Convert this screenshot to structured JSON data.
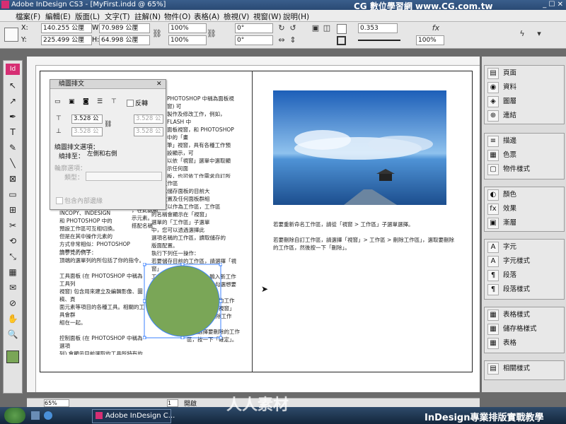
{
  "window": {
    "title": "Adobe InDesign CS3 - [MyFirst.indd @ 65%]",
    "brand": "CG 數位學習網 www.CG.com.tw",
    "controls": "_ ☐ ✕"
  },
  "menu": [
    "檔案(F)",
    "編輯(E)",
    "版面(L)",
    "文字(T)",
    "註解(N)",
    "物件(O)",
    "表格(A)",
    "檢視(V)",
    "視窗(W)",
    "說明(H)"
  ],
  "control": {
    "x_label": "X:",
    "x_value": "140.255 公厘",
    "y_label": "Y:",
    "y_value": "225.499 公厘",
    "w_label": "W:",
    "w_value": "70.989 公厘",
    "h_label": "H:",
    "h_value": "64.998 公厘",
    "scale_x": "100%",
    "scale_y": "100%",
    "rotate": "0°",
    "shear": "0°",
    "stroke": "0.353",
    "opacity": "100%"
  },
  "tools": [
    "selection-tool",
    "direct-selection-tool",
    "pen-tool",
    "type-tool",
    "pencil-tool",
    "line-tool",
    "rectangle-frame-tool",
    "rectangle-tool",
    "button-tool",
    "scissors-tool",
    "rotate-tool",
    "scale-tool",
    "gradient-tool",
    "note-tool",
    "eyedropper-tool",
    "hand-tool",
    "zoom-tool"
  ],
  "tool_glyphs": [
    "↖",
    "↗",
    "✒",
    "T",
    "✎",
    "╲",
    "⊠",
    "▭",
    "⊞",
    "✂",
    "⟲",
    "⤡",
    "▦",
    "✉",
    "⊘",
    "✋",
    "🔍"
  ],
  "text_wrap": {
    "title": "繞圖排文",
    "invert": "反轉",
    "top": "3.528 公",
    "bottom": "3.528 公",
    "left": "3.528 公",
    "right": "3.528 公",
    "options_title": "繞圖排文選項：",
    "wrap_to_label": "繞排至：",
    "wrap_to_value": "左側和右側",
    "contour_title": "輪廓選項：",
    "type_label": "類型：",
    "include_inside": "包含內部邊緣"
  },
  "page_text": {
    "left_top": "PHOTOSHOP 中稱為面板視窗) 可\n製作及修改工作，例如，FLASH 中\n面板視窗，和 PHOTOSHOP 中的「畫\n筆」視窗，具有各種工作預設顯示，可\n以依「視窗」選單中選取顯示任何面\n板，也可依工作需求自訂所需的面板\n組合，並儲存為工作區，便於將版面\n設計作業的工作區，選擇數及操作面板\n將 PHOTOSHOP 與 ADOBE CREATIVE\n新增面板中稱為面板視窗)。",
    "left_mid_a": "INCOPY、INDESIGN\n和 PHOTOSHOP 中的\n預設工作區可互相切換。\n但是在其中操作元素的\n方式非常相似：PHOTOSHOP 的預設工作區。",
    "left_mid_b": "大\n工作區，可\n，在此處顯\n示元素。\n搭配名稱",
    "left_list": "請參見的例子：\n頂端的選單列的所包括了你的指令。\n\n工具面板 (在 PHOTOSHOP 中稱為工具列\n視窗) 包含用來建立及編輯影像、圖稿、頁\n面元素等項目的各種工具。相關的工具會群\n組在一起。\n\n控制面板 (在 PHOTOSHOP 中稱為選項\n列) 會顯示目前選取的工具所特有的選項\n(FLASH 沒有「控制」面板)。\n\n文件視窗 (在 FLASH 中稱為舞台) 會顯示您\n正在處理的檔案。",
    "mid_col": "儲存工作區\n您可以儲存面板的目前大\n小和位置及任何面板群組\n的位置以作為工作區，工作區\n的名稱會顯示在「視窗」\n選單的「工作區」子選單\n中，您可以透過選擇此\n選項名稱的工作區，讀取儲存的\n版面配置。\n執行下列任一操作：\n若要儲存目前的工作區，請選擇「視窗」\n工作區 > 儲存工作區」，輸入新工作\n區的名稱，然後在對話框中勾選想要\n包含的選項，再\n按一下「確定」。",
    "mid_bottom": "若要刪除目前的工作\n區，請選擇「視窗」\n工作區 > 刪除工作區」，\n然後選擇要刪除的工作區，按一下「確定」。",
    "right_1": "若要重新命名工作區，請從「視窗 > 工作區」子選單選擇。",
    "right_2": "若要刪除自訂工作區，請選擇「視窗」> 工作區 > 刪除工作區」，選取要刪除的工作區，然後按一下「刪除」。"
  },
  "panels": [
    [
      "頁面",
      "pages-icon"
    ],
    [
      "資料",
      "links-icon"
    ],
    [
      "圖層",
      "layers-icon"
    ],
    [
      "連結",
      "hyperlinks-icon"
    ],
    [
      "描邊",
      "stroke-icon"
    ],
    [
      "色票",
      "swatches-icon"
    ],
    [
      "物件樣式",
      "object-styles-icon"
    ],
    [
      "顏色",
      "color-icon"
    ],
    [
      "效果",
      "effects-icon"
    ],
    [
      "漸層",
      "gradient-icon"
    ],
    [
      "字元",
      "character-icon"
    ],
    [
      "字元樣式",
      "character-styles-icon"
    ],
    [
      "段落",
      "paragraph-icon"
    ],
    [
      "段落樣式",
      "paragraph-styles-icon"
    ],
    [
      "表格樣式",
      "table-styles-icon"
    ],
    [
      "儲存格樣式",
      "cell-styles-icon"
    ],
    [
      "表格",
      "table-icon"
    ],
    [
      "相關樣式",
      "related-styles-icon"
    ]
  ],
  "panel_glyphs": [
    "▤",
    "◉",
    "◈",
    "⊕",
    "≡",
    "▦",
    "▢",
    "◐",
    "fx",
    "▣",
    "A",
    "A",
    "¶",
    "¶",
    "▦",
    "▦",
    "▦",
    "▤"
  ],
  "status": {
    "zoom": "65%",
    "page": "1",
    "state": "開啟"
  },
  "taskbar": {
    "app": "Adobe InDesign C..."
  },
  "course": "InDesign專業排版實戰教學",
  "watermark": "人人素材",
  "colors": {
    "ellipse": "#7aa657",
    "sky_top": "#1d5fb8",
    "sky_bottom": "#8fc2ee",
    "frame": "#3b82ff"
  }
}
